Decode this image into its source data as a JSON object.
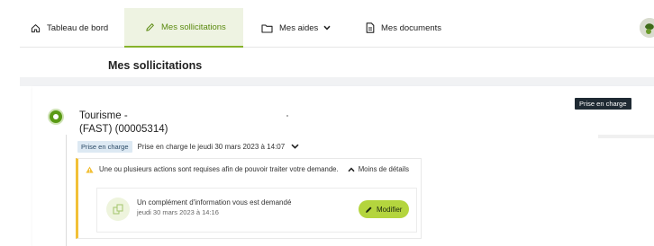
{
  "nav": {
    "home": "Tableau de bord",
    "solicitations": "Mes sollicitations",
    "aides": "Mes aides",
    "documents": "Mes documents"
  },
  "page_title": "Mes sollicitations",
  "request": {
    "title_line1": "Tourisme -",
    "title_line2": "(FAST) (00005314)",
    "status_badge": "Prise en charge",
    "status_pill": "Prise en charge",
    "status_text": "Prise en charge le jeudi 30 mars 2023 à 14:07"
  },
  "alert": {
    "message": "Une ou plusieurs actions sont requises afin de pouvoir traiter votre demande.",
    "toggle": "Moins de détails",
    "item_title": "Un complément d'information vous est demandé",
    "item_date": "jeudi 30 mars 2023 à 14:16",
    "modify_button": "Modifier"
  },
  "colors": {
    "accent": "#86b22a",
    "status_dark": "#1f2a33",
    "warning": "#f2c037",
    "button": "#b4d53e"
  }
}
